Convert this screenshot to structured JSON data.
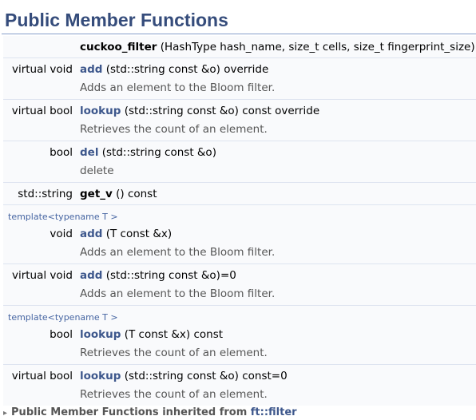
{
  "header": {
    "title": "Public Member Functions"
  },
  "rows": [
    {
      "ret": "",
      "name": "cuckoo_filter",
      "args": " (HashType hash_name, size_t cells, size_t fingerprint_size)",
      "desc": ""
    },
    {
      "ret": "virtual void",
      "name": "add",
      "args": " (std::string const &o) override",
      "desc": "Adds an element to the Bloom filter."
    },
    {
      "ret": "virtual bool",
      "name": "lookup",
      "args": " (std::string const &o) const override",
      "desc": "Retrieves the count of an element."
    },
    {
      "ret": "bool",
      "name": "del",
      "args": " (std::string const &o)",
      "desc": "delete"
    },
    {
      "ret": "std::string",
      "name": "get_v",
      "args": " () const",
      "desc": ""
    },
    {
      "template": "template<typename T >",
      "ret": "void",
      "name": "add",
      "args": " (T const &x)",
      "desc": "Adds an element to the Bloom filter."
    },
    {
      "ret": "virtual void",
      "name": "add",
      "args": " (std::string const &o)=0",
      "desc": "Adds an element to the Bloom filter."
    },
    {
      "template": "template<typename T >",
      "ret": "bool",
      "name": "lookup",
      "args": " (T const &x) const",
      "desc": "Retrieves the count of an element."
    },
    {
      "ret": "virtual bool",
      "name": "lookup",
      "args": " (std::string const &o) const=0",
      "desc": "Retrieves the count of an element."
    }
  ],
  "inherited": {
    "arrow": "▸",
    "prefix": "Public Member Functions inherited from ",
    "link": "ft::filter"
  },
  "colors": {
    "title": "#354c7b",
    "link": "#3d578c",
    "desc": "#555555",
    "row_bg": "#f9fafc",
    "separator": "#dee4f0"
  }
}
